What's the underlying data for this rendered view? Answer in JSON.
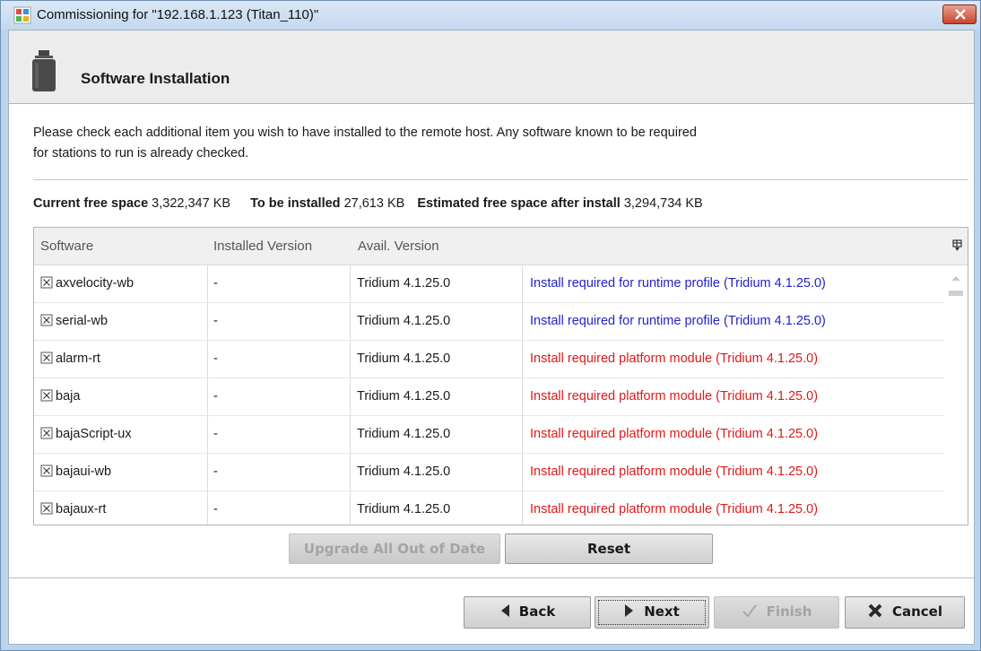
{
  "window": {
    "title": "Commissioning for \"192.168.1.123 (Titan_110)\""
  },
  "header": {
    "title": "Software Installation"
  },
  "description": {
    "line1": "Please check each additional item you wish to have installed to the remote host. Any software known to be required",
    "line2": "for stations to run is already checked."
  },
  "space": {
    "current_label": "Current free space",
    "current_value": "3,322,347 KB",
    "install_label": "To be installed",
    "install_value": "27,613 KB",
    "after_label": "Estimated free space after install",
    "after_value": "3,294,734 KB"
  },
  "table": {
    "headers": [
      "Software",
      "Installed Version",
      "Avail. Version",
      ""
    ],
    "rows": [
      {
        "software": "axvelocity-wb",
        "installed": "-",
        "available": "Tridium 4.1.25.0",
        "note": "Install required for runtime profile (Tridium 4.1.25.0)"
      },
      {
        "software": "serial-wb",
        "installed": "-",
        "available": "Tridium 4.1.25.0",
        "note": "Install required for runtime profile (Tridium 4.1.25.0)"
      },
      {
        "software": "alarm-rt",
        "installed": "-",
        "available": "Tridium 4.1.25.0",
        "note": "Install required platform module (Tridium 4.1.25.0)"
      },
      {
        "software": "baja",
        "installed": "-",
        "available": "Tridium 4.1.25.0",
        "note": "Install required platform module (Tridium 4.1.25.0)"
      },
      {
        "software": "bajaScript-ux",
        "installed": "-",
        "available": "Tridium 4.1.25.0",
        "note": "Install required platform module (Tridium 4.1.25.0)"
      },
      {
        "software": "bajaui-wb",
        "installed": "-",
        "available": "Tridium 4.1.25.0",
        "note": "Install required platform module (Tridium 4.1.25.0)"
      },
      {
        "software": "bajaux-rt",
        "installed": "-",
        "available": "Tridium 4.1.25.0",
        "note": "Install required platform module (Tridium 4.1.25.0)"
      }
    ]
  },
  "buttons": {
    "upgrade": "Upgrade All Out of Date",
    "reset": "Reset",
    "back": "Back",
    "next": "Next",
    "finish": "Finish",
    "cancel": "Cancel"
  },
  "colors": {
    "runtime_note": "#2222cc",
    "platform_note": "#e01818",
    "disabled_text": "#a4a4a4"
  },
  "icons": {
    "app": "niagara-app-icon",
    "header": "software-package-icon",
    "close": "close-icon",
    "checkbox": "checked-box-icon",
    "columns": "column-chooser-icon",
    "back": "arrow-left-icon",
    "next": "arrow-right-icon",
    "finish": "checkmark-icon",
    "cancel": "x-icon"
  }
}
